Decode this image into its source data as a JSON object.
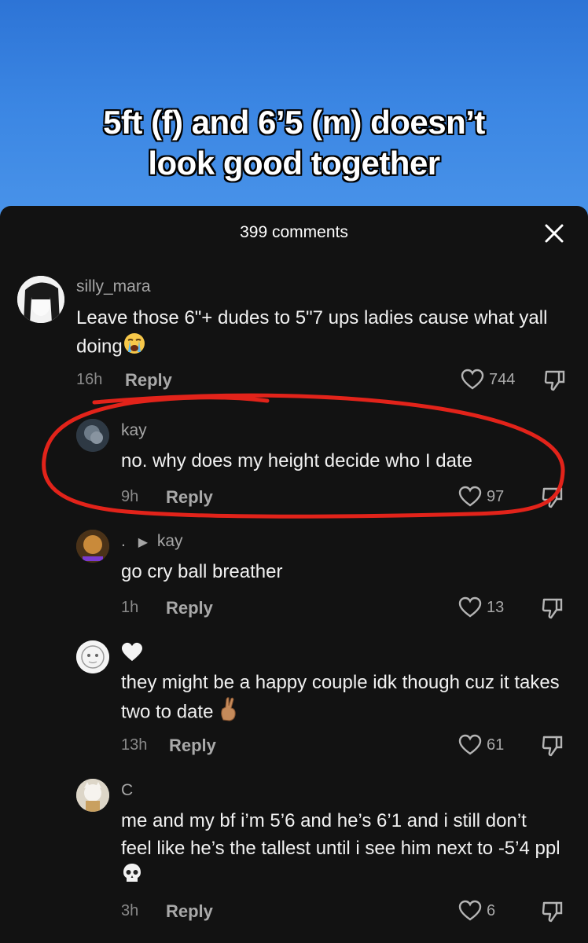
{
  "video": {
    "overlay_title": "5ft (f) and 6’5 (m) doesn’t\nlook good together"
  },
  "sheet": {
    "comment_count": "399 comments"
  },
  "comments": [
    {
      "username": "silly_mara",
      "text": "Leave those 6\"+ dudes to 5\"7 ups ladies cause what yall doing",
      "emoji": "loudly-crying-face",
      "time": "16h",
      "reply_label": "Reply",
      "likes": "744"
    },
    {
      "username": "kay",
      "text": "no. why does my height decide who I date",
      "time": "9h",
      "reply_label": "Reply",
      "likes": "97"
    },
    {
      "username": ".",
      "reply_to": "kay",
      "text": "go cry ball breather",
      "time": "1h",
      "reply_label": "Reply",
      "likes": "13"
    },
    {
      "username_icon": "white-heart",
      "text": "they might be a happy couple idk though cuz it takes two to date",
      "emoji": "crossed-fingers",
      "time": "13h",
      "reply_label": "Reply",
      "likes": "61"
    },
    {
      "username": "C",
      "text": "me and my bf i’m 5’6 and he’s 6’1 and i still don’t feel like he’s the tallest until i see him next to -5’4 ppl",
      "emoji": "skull",
      "time": "3h",
      "reply_label": "Reply",
      "likes": "6"
    }
  ],
  "colors": {
    "annotation": "#e2231a",
    "sheet_bg": "#121212",
    "video_bg": "#3b86e3"
  }
}
